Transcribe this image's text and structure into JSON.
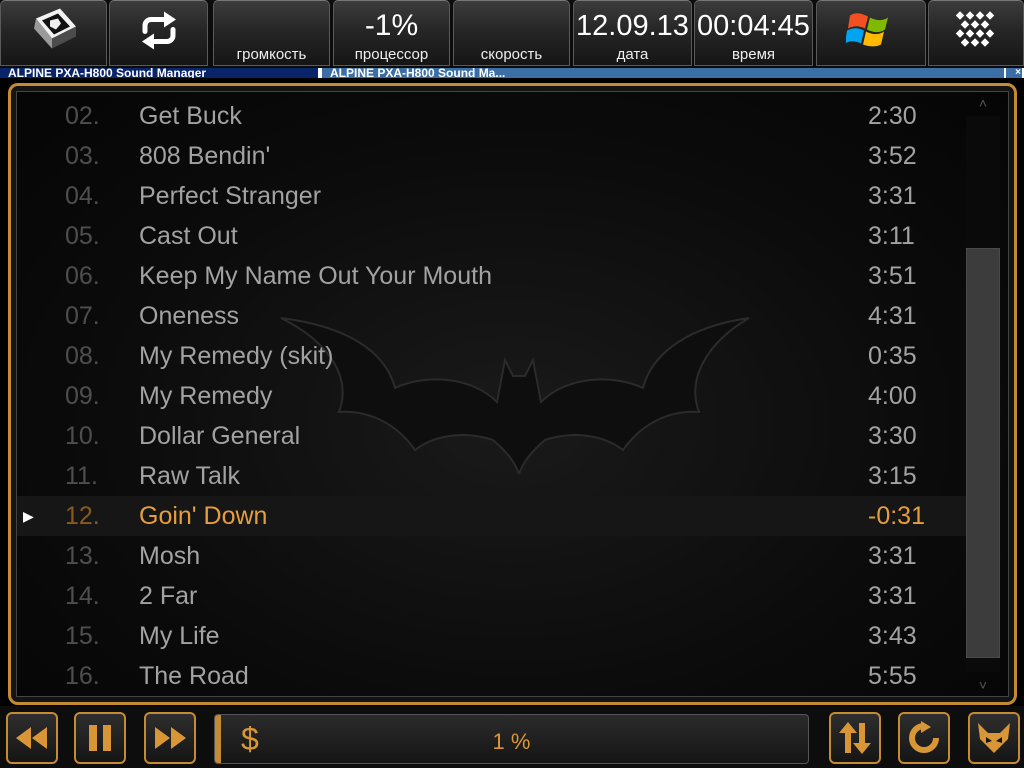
{
  "topbar": {
    "volume_label": "громкость",
    "cpu_value": "-1%",
    "cpu_label": "процессор",
    "speed_label": "скорость",
    "date_value": "12.09.13",
    "date_label": "дата",
    "time_value": "00:04:45",
    "time_label": "время",
    "icons": [
      "keyboard-key-icon",
      "switch-arrows-icon",
      "windows-logo-icon",
      "grid-menu-icon"
    ]
  },
  "windows": {
    "tab1": "ALPINE PXA-H800 Sound Manager",
    "tab2": "ALPINE PXA-H800 Sound Ma..."
  },
  "playlist": {
    "tracks": [
      {
        "num": "02.",
        "title": "Get Buck",
        "duration": "2:30"
      },
      {
        "num": "03.",
        "title": "808 Bendin'",
        "duration": "3:52"
      },
      {
        "num": "04.",
        "title": "Perfect Stranger",
        "duration": "3:31"
      },
      {
        "num": "05.",
        "title": "Cast Out",
        "duration": "3:11"
      },
      {
        "num": "06.",
        "title": "Keep My Name Out Your Mouth",
        "duration": "3:51"
      },
      {
        "num": "07.",
        "title": "Oneness",
        "duration": "4:31"
      },
      {
        "num": "08.",
        "title": "My Remedy (skit)",
        "duration": "0:35"
      },
      {
        "num": "09.",
        "title": "My Remedy",
        "duration": "4:00"
      },
      {
        "num": "10.",
        "title": "Dollar General",
        "duration": "3:30"
      },
      {
        "num": "11.",
        "title": "Raw Talk",
        "duration": "3:15"
      },
      {
        "num": "12.",
        "title": "Goin' Down",
        "duration": "-0:31",
        "playing": true
      },
      {
        "num": "13.",
        "title": "Mosh",
        "duration": "3:31"
      },
      {
        "num": "14.",
        "title": "2 Far",
        "duration": "3:31"
      },
      {
        "num": "15.",
        "title": "My Life",
        "duration": "3:43"
      },
      {
        "num": "16.",
        "title": "The Road",
        "duration": "5:55"
      }
    ],
    "play_marker": "▶",
    "scroll_up": "˄",
    "scroll_down": "˅"
  },
  "player": {
    "progress_symbol": "$",
    "progress_text": "1 %",
    "progress_fraction": 0.01
  },
  "colors": {
    "accent": "#c58a34",
    "active_text": "#e59e3c",
    "track_text": "#a2a2a2",
    "track_number": "#4e4e4e"
  }
}
